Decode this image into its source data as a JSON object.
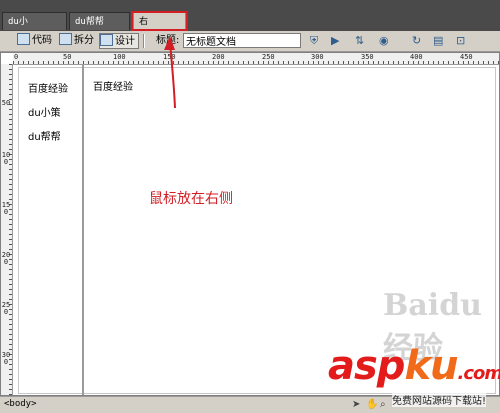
{
  "tabs": [
    {
      "label": "du小策.html"
    },
    {
      "label": "du帮帮 html"
    },
    {
      "label": "右侧.html"
    }
  ],
  "toolbar": {
    "code": "代码",
    "split": "拆分",
    "design": "设计",
    "title_label": "标题:",
    "title_value": "无标题文档"
  },
  "ruler_top": [
    "0",
    "50",
    "100",
    "150",
    "200",
    "250",
    "300",
    "350",
    "400",
    "450"
  ],
  "ruler_left": [
    "50",
    "100",
    "150",
    "200",
    "250",
    "300"
  ],
  "left_frame": [
    "百度经验",
    "du小策",
    "du帮帮"
  ],
  "right_frame": {
    "heading": "百度经验"
  },
  "annotation": "鼠标放在右侧",
  "status": {
    "tag": "<body>"
  },
  "watermark": {
    "baidu": "Baidu经验",
    "asp": "asp",
    "ku": "ku",
    "com": ".com",
    "sub": "免费网站源码下载站!"
  },
  "colors": {
    "highlight": "#d21e24"
  }
}
